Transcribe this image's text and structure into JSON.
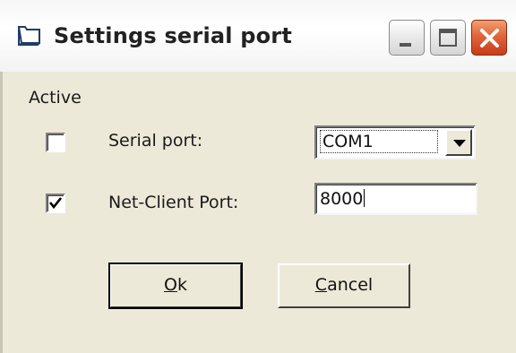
{
  "window": {
    "title": "Settings serial port",
    "icon": "folder-window-icon",
    "controls": [
      "minimize-icon",
      "maximize-icon",
      "close-icon"
    ]
  },
  "form": {
    "active_label": "Active",
    "serial": {
      "checked": false,
      "label": "Serial port:",
      "selected": "COM1"
    },
    "netclient": {
      "checked": true,
      "label": "Net-Client Port:",
      "value": "8000"
    }
  },
  "buttons": {
    "ok": {
      "accel": "O",
      "rest": "k"
    },
    "cancel": {
      "accel": "C",
      "rest": "ancel"
    }
  },
  "colors": {
    "dialog_bg": "#ece9d8",
    "close_button": "#e2643a"
  }
}
